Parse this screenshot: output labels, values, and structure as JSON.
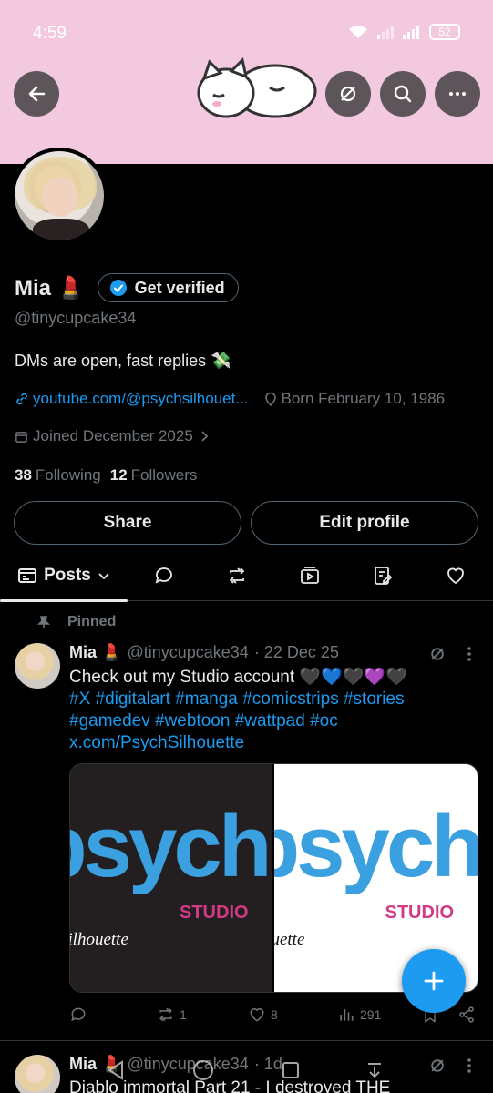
{
  "status_bar": {
    "time": "4:59",
    "battery": "52"
  },
  "header": {
    "back_icon": "arrow-left-icon",
    "grok_icon": "slash-circle-icon",
    "search_icon": "search-icon",
    "more_icon": "more-horizontal-icon"
  },
  "profile": {
    "name": "Mia",
    "name_emoji": "💄",
    "get_verified_label": "Get verified",
    "handle": "@tinycupcake34",
    "bio": "DMs are open, fast replies 💸",
    "link": "youtube.com/@psychsilhouet...",
    "born": "Born February 10, 1986",
    "joined": "Joined December 2025",
    "following_count": "38",
    "following_label": "Following",
    "followers_count": "12",
    "followers_label": "Followers",
    "share_label": "Share",
    "edit_profile_label": "Edit profile"
  },
  "tabs": {
    "posts_label": "Posts",
    "icons": [
      "replies-icon",
      "reposts-icon",
      "media-icon",
      "articles-icon",
      "likes-icon"
    ]
  },
  "pinned_tweet": {
    "pinned_label": "Pinned",
    "name": "Mia",
    "emoji": "💄",
    "handle": "@tinycupcake34",
    "date": "· 22 Dec 25",
    "text": "Check out my Studio account 🖤💙🖤💜🖤",
    "hashtags_line1": "#X #digitalart #manga #comicstrips #stories",
    "hashtags_line2": "#gamedev #webtoon #wattpad #oc",
    "url": "x.com/PsychSilhouette",
    "media_text": {
      "word": "psych",
      "studio": "STUDIO",
      "signature": "silhouette"
    },
    "replies": "",
    "reposts": "1",
    "likes": "8",
    "views": "291"
  },
  "second_tweet": {
    "name": "Mia",
    "emoji": "💄",
    "handle": "@tinycupcake34",
    "date": "· 1d",
    "text": "Diablo immortal Part 21 - I destroyed THE"
  },
  "colors": {
    "banner": "#f2c9df",
    "accent": "#1d9bf0",
    "background": "#000000"
  }
}
